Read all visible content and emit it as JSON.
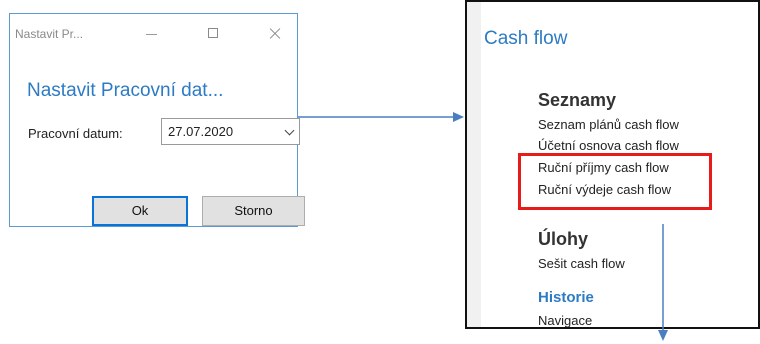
{
  "dialog": {
    "window_title": "Nastavit Pr...",
    "heading": "Nastavit Pracovní dat...",
    "field_label": "Pracovní datum:",
    "date_value": "27.07.2020",
    "ok_label": "Ok",
    "cancel_label": "Storno"
  },
  "panel": {
    "title": "Cash flow",
    "sections": {
      "seznamy": {
        "heading": "Seznamy",
        "items": [
          "Seznam plánů cash flow",
          "Účetní osnova cash flow",
          "Ruční příjmy cash flow",
          "Ruční výdeje cash flow"
        ]
      },
      "ulohy": {
        "heading": "Úlohy",
        "items": [
          "Sešit cash flow"
        ]
      },
      "historie": {
        "heading": "Historie",
        "items": [
          "Navigace"
        ]
      }
    }
  },
  "colors": {
    "accent": "#2d7bc4",
    "highlight": "#e81b1b",
    "arrow": "#4a7fbf"
  },
  "icons": {
    "minimize": "minimize-icon",
    "maximize": "maximize-icon",
    "close": "close-icon",
    "dropdown": "chevron-down-icon"
  }
}
